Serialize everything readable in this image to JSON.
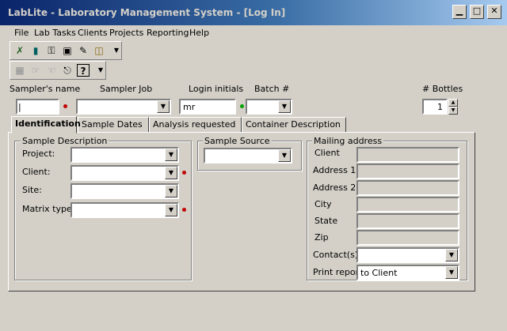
{
  "window": {
    "title": "LabLite - Laboratory Management System - [Log In]"
  },
  "menu": [
    "File",
    "Lab Tasks",
    "Clients",
    "Projects",
    "Reporting",
    "Help"
  ],
  "header": {
    "sampler_name_label": "Sampler's name",
    "sampler_job_label": "Sampler Job",
    "login_initials_label": "Login initials",
    "login_initials_value": "mr",
    "batch_label": "Batch #",
    "bottles_label": "# Bottles",
    "bottles_value": "1"
  },
  "tabs": [
    "Identification",
    "Sample Dates",
    "Analysis requested",
    "Container Description"
  ],
  "sample_description": {
    "title": "Sample Description",
    "project_label": "Project:",
    "client_label": "Client:",
    "site_label": "Site:",
    "matrix_label": "Matrix type:"
  },
  "sample_source": {
    "title": "Sample Source"
  },
  "mailing": {
    "title": "Mailing address",
    "client_label": "Client",
    "address1_label": "Address 1",
    "address2_label": "Address 2",
    "city_label": "City",
    "state_label": "State",
    "zip_label": "Zip",
    "contacts_label": "Contact(s)",
    "print_report_label": "Print report",
    "print_report_value": "to Client"
  },
  "colors": {
    "required_marker": "#c00000",
    "optional_marker": "#00a000"
  }
}
